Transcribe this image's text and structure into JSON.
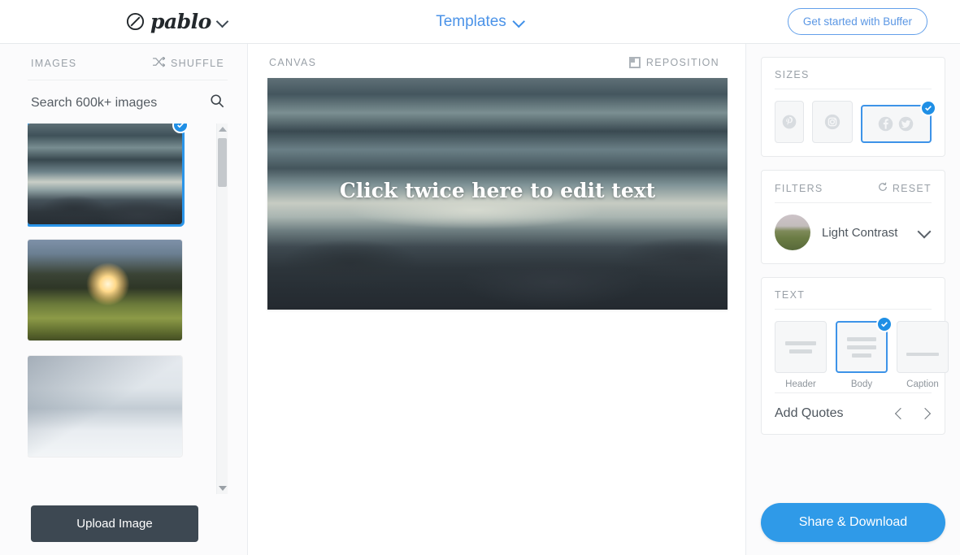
{
  "header": {
    "brand_name": "pablo",
    "brand_icon": "pablo-circle-slash-icon",
    "brand_chevron": "chevron-down-icon",
    "templates_label": "Templates",
    "templates_chevron": "chevron-down-icon",
    "get_started_label": "Get started with Buffer"
  },
  "images_panel": {
    "title": "IMAGES",
    "shuffle_label": "SHUFFLE",
    "shuffle_icon": "shuffle-icon",
    "search_placeholder": "Search 600k+ images",
    "search_value": "",
    "search_icon": "search-icon",
    "thumbnails": [
      {
        "name": "ocean-waves-rocks",
        "selected": true
      },
      {
        "name": "sunset-through-trees",
        "selected": false
      },
      {
        "name": "snowy-forest-skier",
        "selected": false
      }
    ],
    "upload_label": "Upload Image",
    "scroll_up_icon": "triangle-up-icon",
    "scroll_down_icon": "triangle-down-icon"
  },
  "canvas_panel": {
    "title": "CANVAS",
    "reposition_label": "REPOSITION",
    "reposition_icon": "reposition-square-icon",
    "canvas_text": "Click twice here to edit text"
  },
  "sizes": {
    "title": "SIZES",
    "options": [
      {
        "label": "Pinterest",
        "icon": "pinterest-icon",
        "selected": false
      },
      {
        "label": "Instagram",
        "icon": "instagram-icon",
        "selected": false
      },
      {
        "label": "Facebook & Twitter",
        "icon": "facebook-twitter-icon",
        "selected": true
      }
    ]
  },
  "filters": {
    "title": "FILTERS",
    "reset_label": "RESET",
    "reset_icon": "reset-circle-icon",
    "selected_filter": "Light Contrast",
    "chevron_icon": "chevron-down-icon"
  },
  "text": {
    "title": "TEXT",
    "options": [
      {
        "label": "Header",
        "selected": false
      },
      {
        "label": "Body",
        "selected": true
      },
      {
        "label": "Caption",
        "selected": false
      }
    ],
    "quotes_label": "Add Quotes",
    "prev_icon": "chevron-left-icon",
    "next_icon": "chevron-right-icon"
  },
  "actions": {
    "share_label": "Share & Download"
  },
  "colors": {
    "accent_blue": "#2f9ae8",
    "link_blue": "#4b93e8",
    "dark_slate": "#3d4852",
    "muted_gray": "#9aa1a8"
  }
}
